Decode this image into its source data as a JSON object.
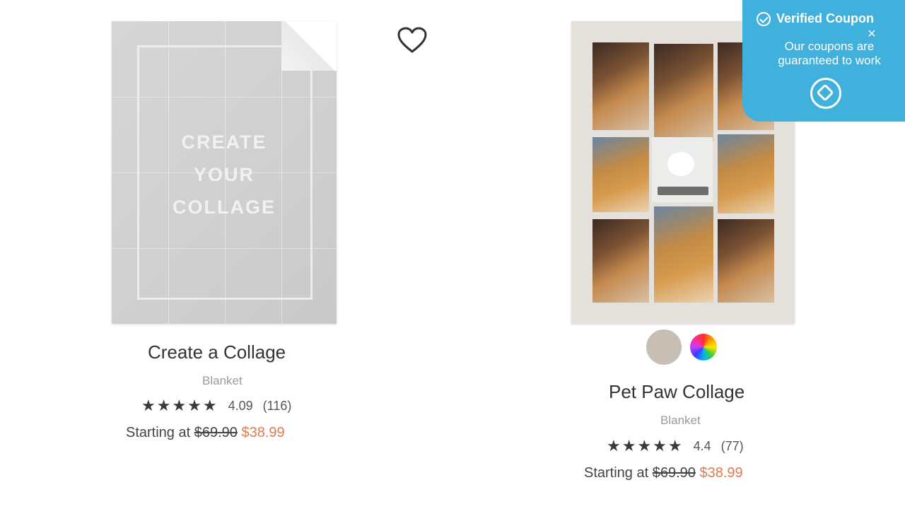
{
  "products": [
    {
      "blanket_text": [
        "CREATE",
        "YOUR",
        "COLLAGE"
      ],
      "title": "Create a Collage",
      "type": "Blanket",
      "stars": "★★★★★",
      "rating": "4.09",
      "review_count": "(116)",
      "price_prefix": "Starting at ",
      "original_price": "$69.90",
      "sale_price": "$38.99"
    },
    {
      "title": "Pet Paw Collage",
      "type": "Blanket",
      "stars": "★★★★★",
      "rating": "4.4",
      "review_count": "(77)",
      "price_prefix": "Starting at ",
      "original_price": "$69.90",
      "sale_price": "$38.99",
      "swatches": [
        "#c7beb4",
        "multicolor"
      ]
    }
  ],
  "coupon": {
    "title": "Verified Coupon",
    "body": "Our coupons are guaranteed to work",
    "icons": [
      "check-circle-icon",
      "coupon-tag-icon",
      "close-icon"
    ]
  },
  "colors": {
    "sale_price": "#e07b4f",
    "coupon_bg": "#3fb1dc"
  },
  "icons": {
    "favorite": "heart-icon"
  }
}
